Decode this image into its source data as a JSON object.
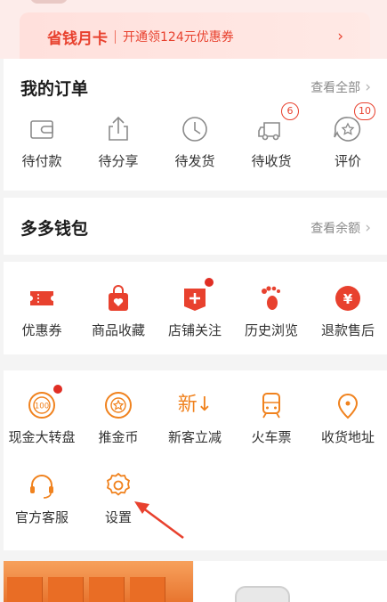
{
  "month_card": {
    "title": "省钱月卡",
    "subtitle": "开通领124元优惠券",
    "arrow": "›"
  },
  "orders": {
    "title": "我的订单",
    "more": "查看全部",
    "items": [
      {
        "label": "待付款",
        "icon": "wallet-icon"
      },
      {
        "label": "待分享",
        "icon": "share-icon"
      },
      {
        "label": "待发货",
        "icon": "clock-icon"
      },
      {
        "label": "待收货",
        "icon": "truck-icon",
        "badge": "6"
      },
      {
        "label": "评价",
        "icon": "review-icon",
        "badge": "10"
      }
    ]
  },
  "wallet": {
    "title": "多多钱包",
    "more": "查看余额"
  },
  "quick": {
    "items": [
      {
        "label": "优惠券",
        "icon": "coupon-icon"
      },
      {
        "label": "商品收藏",
        "icon": "favorite-bag-icon"
      },
      {
        "label": "店铺关注",
        "icon": "store-follow-icon",
        "dot": true
      },
      {
        "label": "历史浏览",
        "icon": "footprint-icon"
      },
      {
        "label": "退款售后",
        "icon": "refund-icon"
      }
    ]
  },
  "services": {
    "items": [
      {
        "label": "现金大转盘",
        "icon": "cash-wheel-icon",
        "icon_text": "100",
        "dot": true
      },
      {
        "label": "推金币",
        "icon": "coin-icon"
      },
      {
        "label": "新客立减",
        "icon": "new-customer-icon",
        "icon_text": "新↓"
      },
      {
        "label": "火车票",
        "icon": "train-icon"
      },
      {
        "label": "收货地址",
        "icon": "location-icon"
      },
      {
        "label": "官方客服",
        "icon": "headset-icon"
      },
      {
        "label": "设置",
        "icon": "settings-icon"
      }
    ]
  },
  "colors": {
    "accent": "#e8412e",
    "icon_orange": "#f0821e",
    "icon_gray": "#8a8a8a"
  }
}
